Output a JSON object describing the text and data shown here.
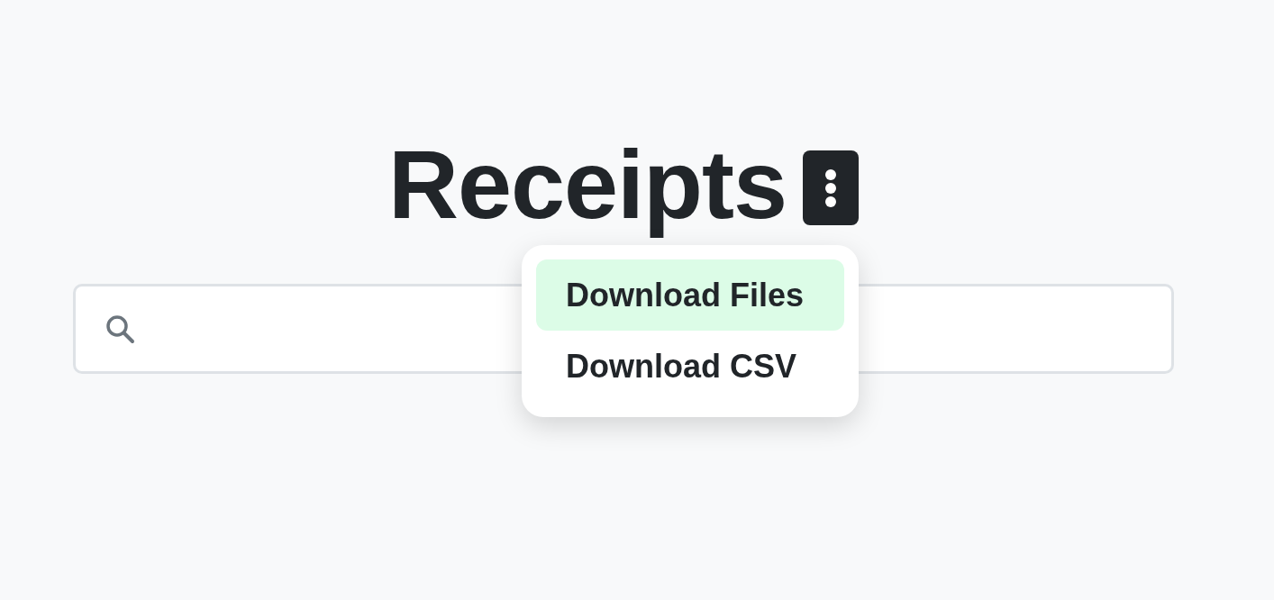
{
  "title": "Receipts",
  "menu": {
    "expanded": true,
    "items": [
      {
        "label": "Download Files",
        "selected": true
      },
      {
        "label": "Download CSV",
        "selected": false
      }
    ]
  }
}
